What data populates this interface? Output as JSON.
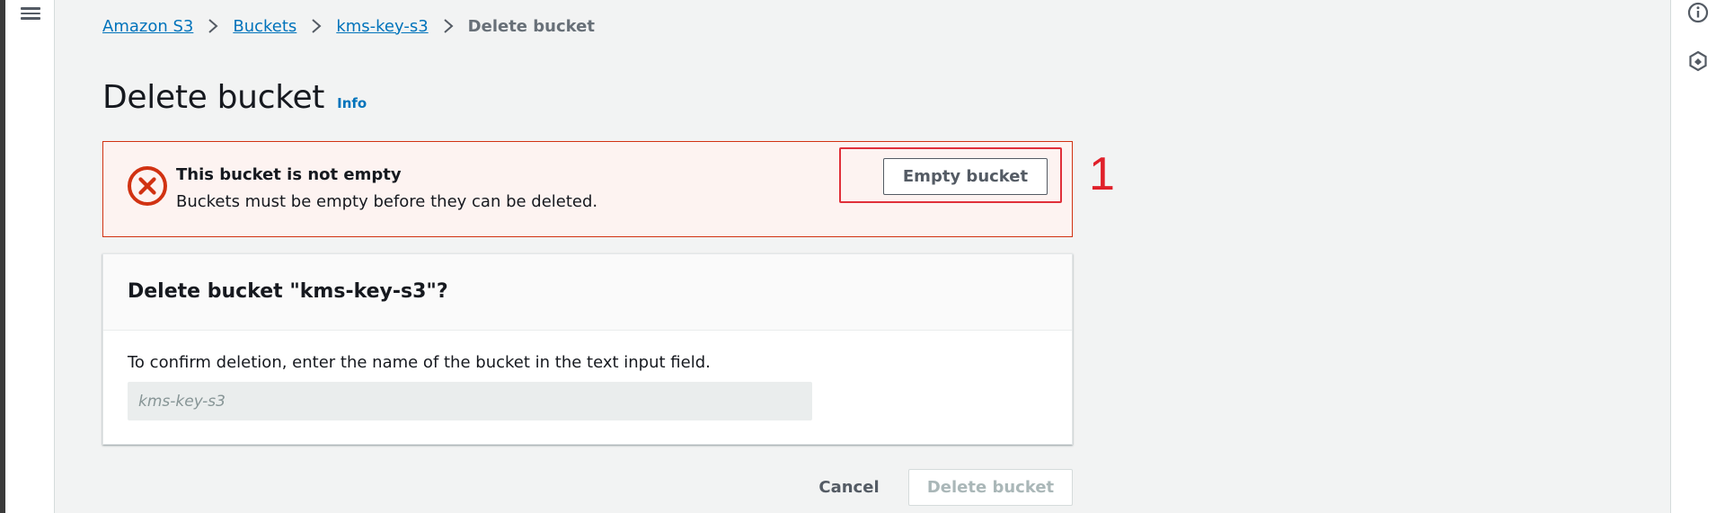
{
  "nav": {
    "menu_icon": "hamburger-menu-icon"
  },
  "side_panel": {
    "icons": [
      "info-circle-icon",
      "hexagon-shield-icon"
    ]
  },
  "breadcrumb": {
    "items": [
      "Amazon S3",
      "Buckets",
      "kms-key-s3"
    ],
    "current": "Delete bucket"
  },
  "page": {
    "title": "Delete bucket",
    "info_label": "Info"
  },
  "alert": {
    "title": "This bucket is not empty",
    "message": "Buckets must be empty before they can be deleted.",
    "action_label": "Empty bucket",
    "color": "#d13212"
  },
  "annotation": {
    "number": "1",
    "color": "#e0202a"
  },
  "confirm_panel": {
    "title": "Delete bucket \"kms-key-s3\"?",
    "label": "To confirm deletion, enter the name of the bucket in the text input field.",
    "input_value": "",
    "input_placeholder": "kms-key-s3"
  },
  "actions": {
    "cancel_label": "Cancel",
    "delete_label": "Delete bucket"
  },
  "colors": {
    "link": "#0073bb",
    "background": "#f2f3f3"
  }
}
